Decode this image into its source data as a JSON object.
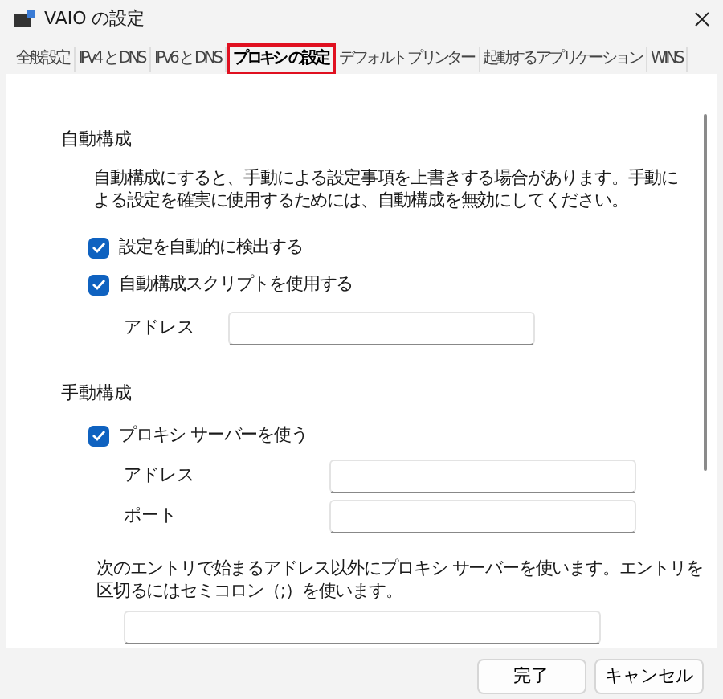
{
  "window": {
    "title": "VAIO の設定"
  },
  "tabs": [
    {
      "label": "全般設定",
      "selected": false
    },
    {
      "label": "IPv4 と DNS",
      "selected": false
    },
    {
      "label": "IPv6 と DNS",
      "selected": false
    },
    {
      "label": "プロキシ の設定",
      "selected": true
    },
    {
      "label": "デフォルト プリンター",
      "selected": false
    },
    {
      "label": "起動するアプリケーション",
      "selected": false
    },
    {
      "label": "WINS",
      "selected": false
    }
  ],
  "auto_config": {
    "heading": "自動構成",
    "note": "自動構成にすると、手動による設定事項を上書きする場合があります。手動による設定を確実に使用するためには、自動構成を無効にしてください。",
    "options": [
      {
        "label": "設定を自動的に検出する",
        "checked": true
      },
      {
        "label": "自動構成スクリプトを使用する",
        "checked": true
      }
    ],
    "fields": [
      {
        "label": "アドレス"
      }
    ]
  },
  "manual_config": {
    "heading": "手動構成",
    "options": [
      {
        "label": "プロキシ サーバーを使う",
        "checked": true
      }
    ],
    "fields": [
      {
        "label": "アドレス"
      },
      {
        "label": "ポート"
      }
    ],
    "exceptions_note": "次のエントリで始まるアドレス以外にプロキシ サーバーを使います。エントリを区切るにはセミコロン（;）を使います。"
  },
  "buttons": [
    "完了",
    "キャンセル"
  ]
}
